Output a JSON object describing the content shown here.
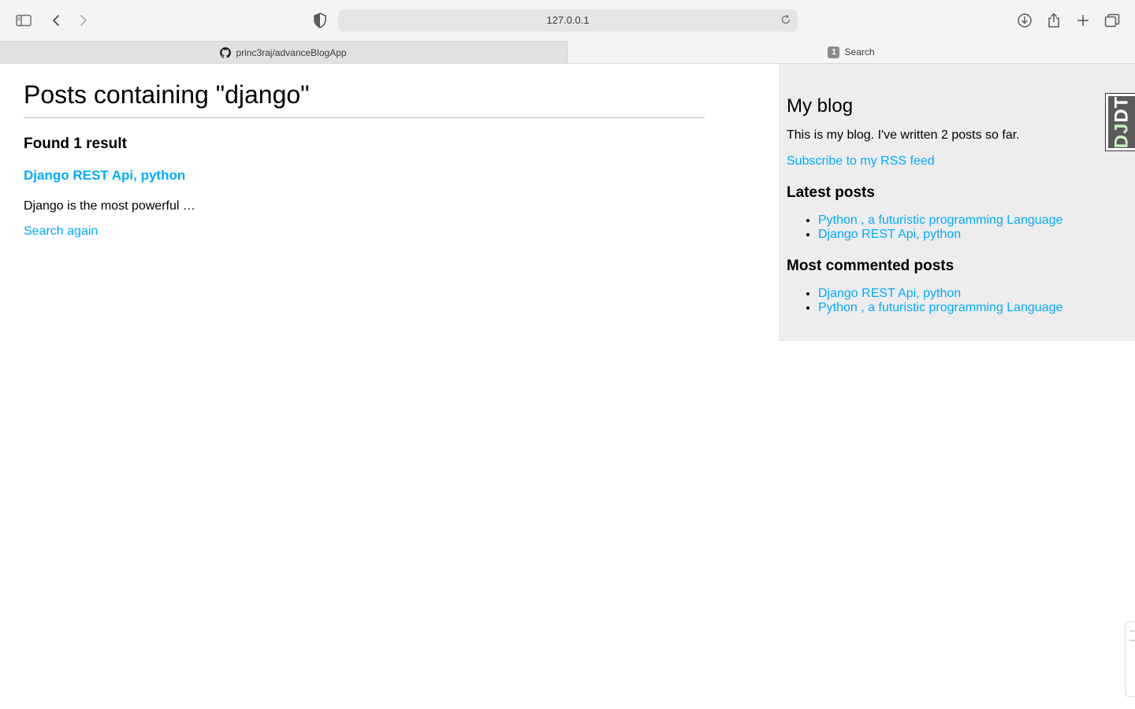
{
  "browser": {
    "url": "127.0.0.1",
    "tabs": [
      {
        "label": "princ3raj/advanceBlogApp",
        "icon": "github-icon",
        "active": false
      },
      {
        "label": "Search",
        "badge": "1",
        "active": true
      }
    ]
  },
  "main": {
    "title": "Posts containing \"django\"",
    "result_count": "Found 1 result",
    "results": [
      {
        "title": "Django REST Api, python",
        "snippet": "Django is the most powerful …"
      }
    ],
    "search_again": "Search again"
  },
  "sidebar": {
    "title": "My blog",
    "intro": "This is my blog. I've written 2 posts so far.",
    "rss_link": "Subscribe to my RSS feed",
    "latest_heading": "Latest posts",
    "latest_posts": [
      "Python , a futuristic programming Language",
      "Django REST Api, python"
    ],
    "most_commented_heading": "Most commented posts",
    "most_commented_posts": [
      "Django REST Api, python",
      "Python , a futuristic programming Language"
    ]
  },
  "debug_toolbar": {
    "label_dj": "DJ",
    "label_dt": "DT"
  },
  "colors": {
    "link": "#00abff",
    "sidebar_bg": "#ededed"
  }
}
